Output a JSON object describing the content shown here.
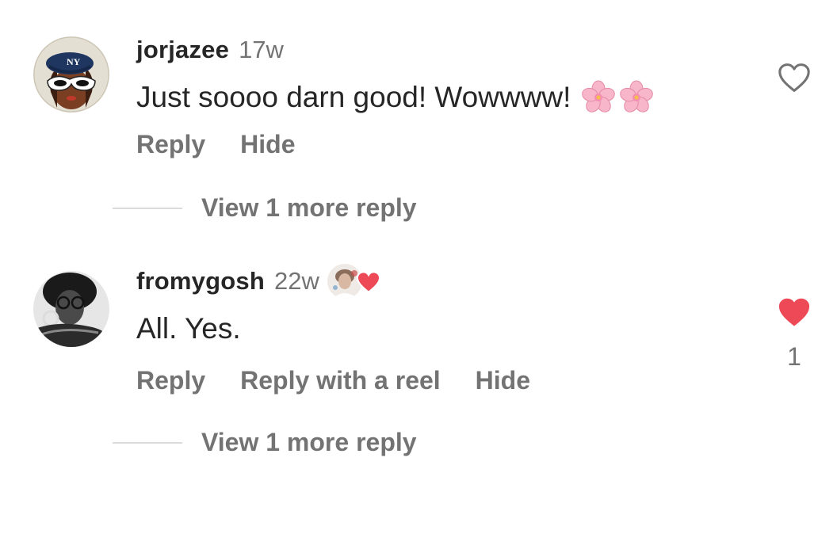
{
  "comments": [
    {
      "username": "jorjazee",
      "time": "17w",
      "text": "Just soooo darn good! Wowwww!",
      "emoji": "cherry-blossom x2",
      "actions": [
        "Reply",
        "Hide"
      ],
      "view_more": "View 1 more reply",
      "liked": false,
      "like_count": ""
    },
    {
      "username": "fromygosh",
      "time": "22w",
      "text": "All. Yes.",
      "creator_liked": true,
      "actions": [
        "Reply",
        "Reply with a reel",
        "Hide"
      ],
      "view_more": "View 1 more reply",
      "liked": true,
      "like_count": "1"
    }
  ],
  "icons": {
    "like_outline": "heart-outline-icon",
    "like_filled": "heart-filled-icon",
    "creator_liked_heart": "heart-filled-icon",
    "emoji": "cherry-blossom-icon"
  },
  "colors": {
    "text_primary": "#262626",
    "text_secondary": "#737373",
    "heart_red": "#ed4956",
    "divider": "#dbdbdb"
  }
}
